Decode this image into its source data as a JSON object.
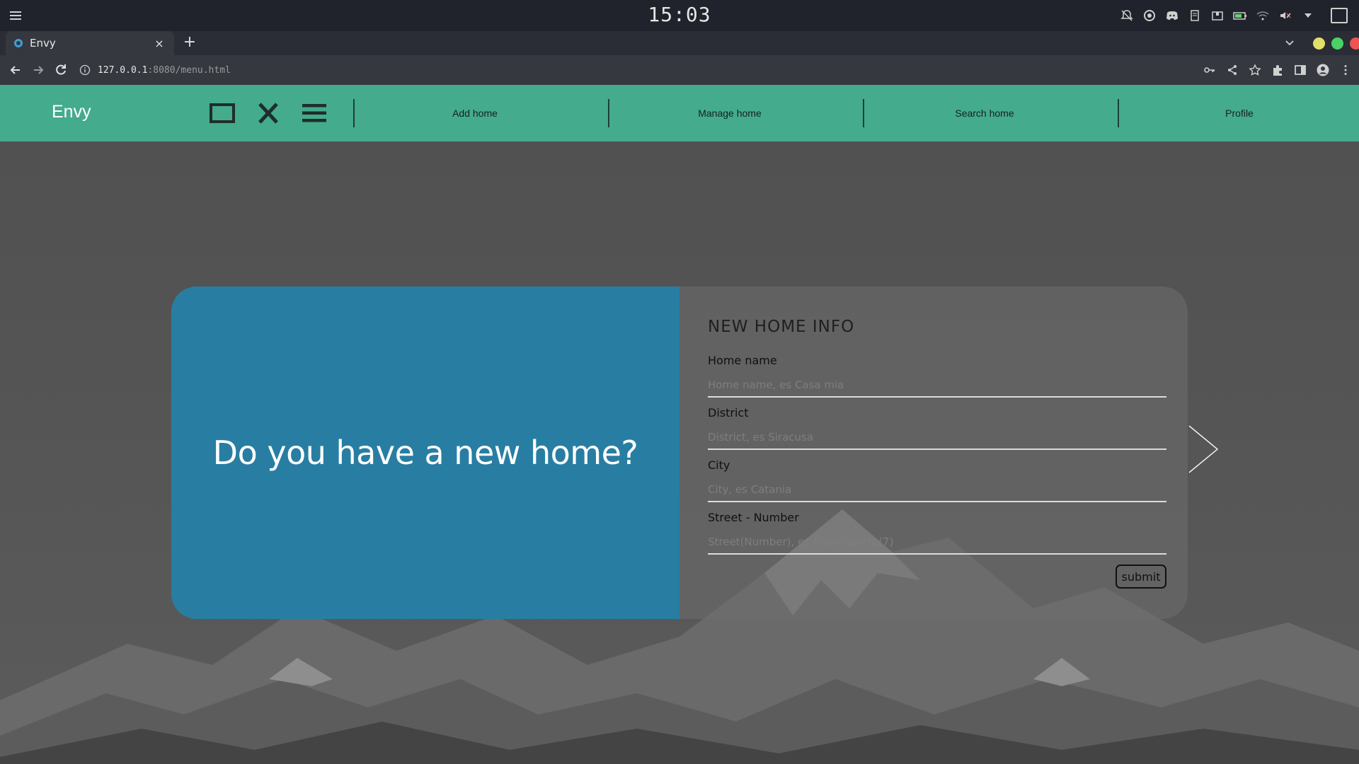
{
  "os": {
    "clock": "15:03",
    "tray_icons": [
      "bell-off-icon",
      "chrome-icon",
      "discord-icon",
      "clipboard-icon",
      "package-icon",
      "battery-icon",
      "wifi-icon",
      "volume-muted-icon",
      "dropdown-icon"
    ]
  },
  "browser": {
    "tab_title": "Envy",
    "tab_close": "×",
    "new_tab": "+",
    "url_host": "127.0.0.1",
    "url_rest": ":8080/menu.html"
  },
  "site": {
    "brand": "Envy",
    "nav_icons": [
      "square-icon",
      "close-icon",
      "hamburger-menu-icon"
    ],
    "nav_links": [
      "Add home",
      "Manage home",
      "Search home",
      "Profile"
    ],
    "nav_color": "#44ab8c"
  },
  "card": {
    "headline": "Do you have a new home?",
    "form_title": "NEW HOME INFO",
    "fields": [
      {
        "label": "Home name",
        "placeholder": "Home name, es Casa mia",
        "value": ""
      },
      {
        "label": "District",
        "placeholder": "District, es Siracusa",
        "value": ""
      },
      {
        "label": "City",
        "placeholder": "City, es Catania",
        "value": ""
      },
      {
        "label": "Street - Number",
        "placeholder": "Street(Number), es Ramondetta(7)",
        "value": ""
      }
    ],
    "submit_label": "submit",
    "accent_color": "#287ea2"
  }
}
